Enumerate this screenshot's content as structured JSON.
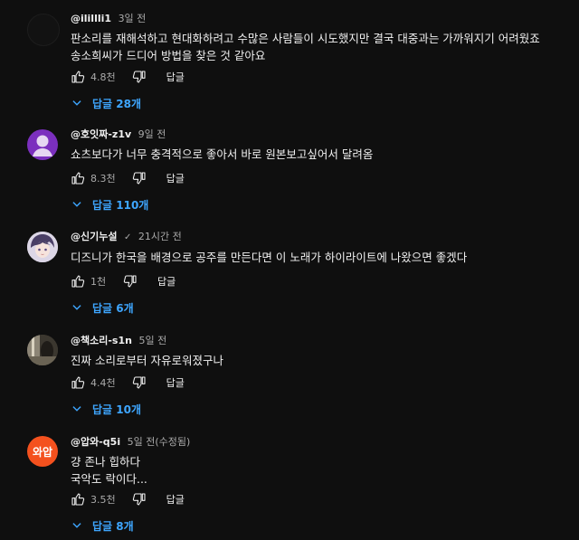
{
  "labels": {
    "reply": "답글"
  },
  "comments": [
    {
      "author": "@ilillli1",
      "time": "3일 전",
      "verified": false,
      "text": "판소리를 재해석하고 현대화하려고 수많은 사람들이 시도했지만 결국 대중과는 가까워지기 어려웠죠\n송소희씨가 드디어 방법을 찾은 것 같아요",
      "likes": "4.8천",
      "replies": "답글 28개",
      "avatar": {
        "type": "dark",
        "color": "#1a1a1a"
      }
    },
    {
      "author": "@호잇짜-z1v",
      "time": "9일 전",
      "verified": false,
      "text": "쇼츠보다가 너무 충격적으로 좋아서 바로 원본보고싶어서 달려옴",
      "likes": "8.3천",
      "replies": "답글 110개",
      "avatar": {
        "type": "person",
        "color": "#7b2fbe"
      }
    },
    {
      "author": "@신기누설",
      "time": "21시간 전",
      "verified": true,
      "text": "디즈니가 한국을 배경으로 공주를 만든다면 이 노래가 하이라이트에 나왔으면 좋겠다",
      "likes": "1천",
      "replies": "답글 6개",
      "avatar": {
        "type": "anime",
        "color": "#d9d3e3"
      }
    },
    {
      "author": "@책소리-s1n",
      "time": "5일 전",
      "verified": false,
      "text": "진짜 소리로부터 자유로워졌구나",
      "likes": "4.4천",
      "replies": "답글 10개",
      "avatar": {
        "type": "photo",
        "color": "#4a463e"
      }
    },
    {
      "author": "@압와-q5i",
      "time": "5일 전(수정됨)",
      "verified": false,
      "text": "걍 존나 힙하다\n국악도 락이다...",
      "likes": "3.5천",
      "replies": "답글 8개",
      "avatar": {
        "type": "text",
        "text": "와압",
        "color": "#f4511e"
      }
    }
  ]
}
